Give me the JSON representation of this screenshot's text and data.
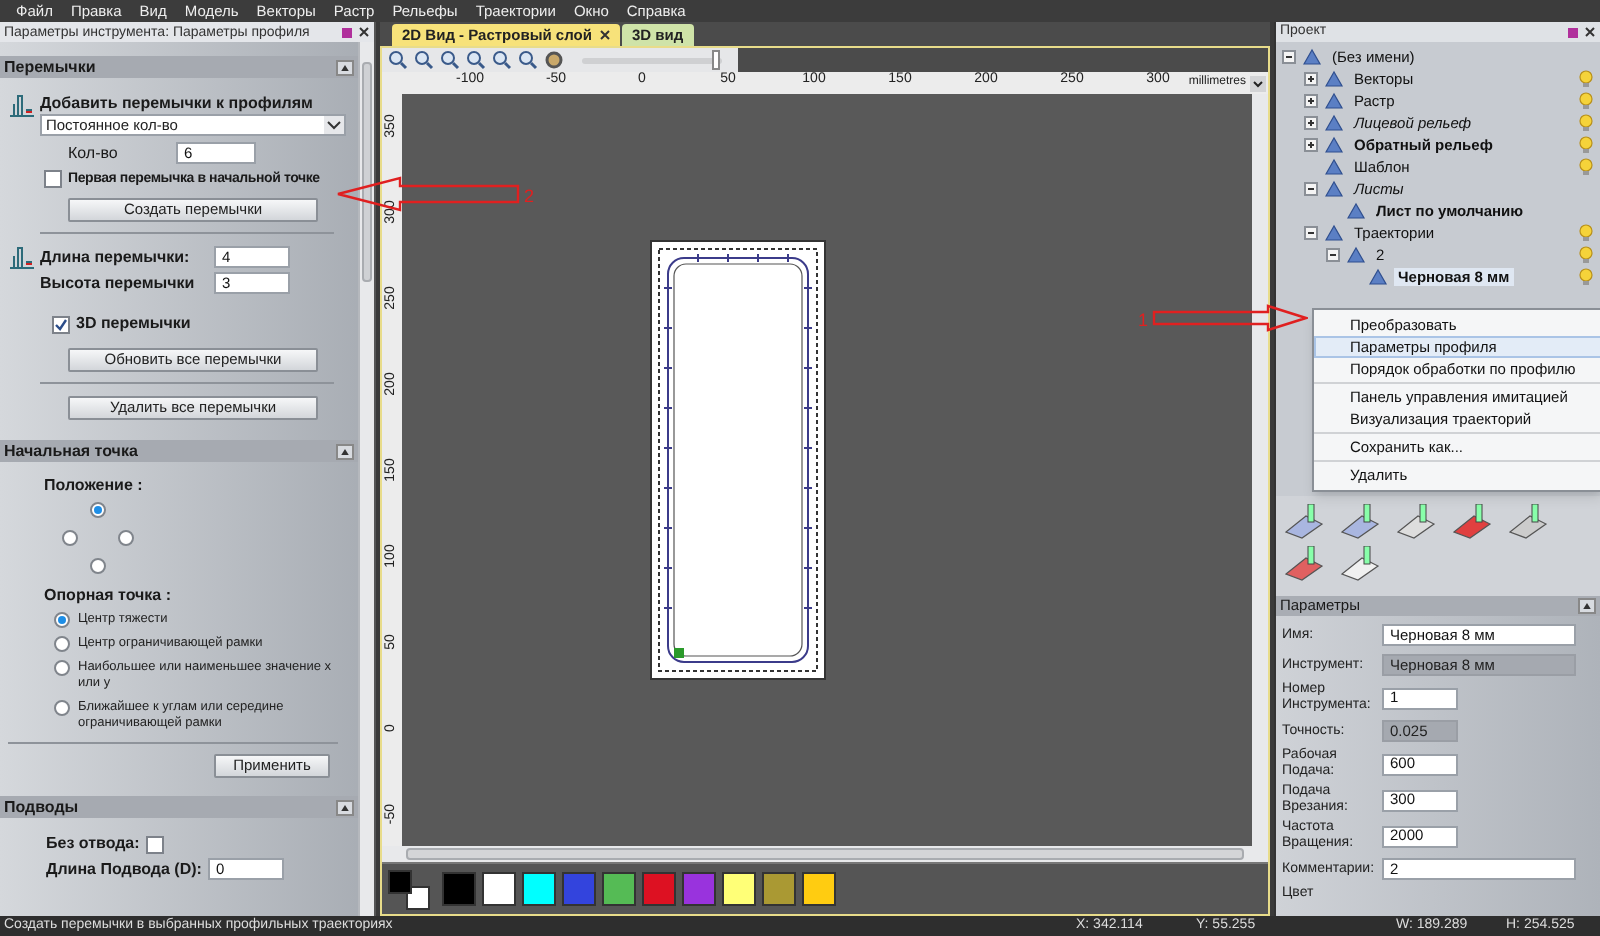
{
  "menu": [
    "Файл",
    "Правка",
    "Вид",
    "Модель",
    "Векторы",
    "Растр",
    "Рельефы",
    "Траектории",
    "Окно",
    "Справка"
  ],
  "left_panel": {
    "title": "Параметры инструмента: Параметры профиля",
    "bridges": {
      "header": "Перемычки",
      "expanded": true,
      "add_label": "Добавить перемычки к профилям",
      "mode": "Постоянное кол-во",
      "count": {
        "label": "Кол-во",
        "value": "6"
      },
      "first_at_start": {
        "label": "Первая перемычка в начальной точке",
        "checked": false
      },
      "create_button": "Создать перемычки",
      "length": {
        "label": "Длина перемычки:",
        "value": "4"
      },
      "height": {
        "label": "Высота перемычки",
        "value": "3"
      },
      "bridges_3d": {
        "label": "3D перемычки",
        "checked": true
      },
      "update_button": "Обновить все перемычки",
      "delete_button": "Удалить все перемычки"
    },
    "start_point": {
      "header": "Начальная точка",
      "expanded": true,
      "position_label": "Положение :",
      "positions": [
        {
          "selected": true
        },
        {
          "selected": false
        },
        {
          "selected": false
        },
        {
          "selected": false
        }
      ],
      "anchor_label": "Опорная точка :",
      "anchors": [
        {
          "label": "Центр тяжести",
          "selected": true
        },
        {
          "label": "Центр ограничивающей рамки",
          "selected": false
        },
        {
          "label": "Наибольшее или наименьшее значение x или y",
          "selected": false
        },
        {
          "label": "Ближайшее к углам или середине ограничивающей рамки",
          "selected": false
        }
      ],
      "apply_button": "Применить"
    },
    "leads": {
      "header": "Подводы",
      "expanded": true,
      "no_lead": {
        "label": "Без отвода:",
        "checked": false
      },
      "lead_length": {
        "label": "Длина Подвода (D):",
        "value": "0"
      }
    }
  },
  "view": {
    "tabs": [
      {
        "label": "2D Вид - Растровый слой",
        "selected": true
      },
      {
        "label": "3D вид",
        "selected": false
      }
    ],
    "zoom_slider": {
      "level": 0.95
    },
    "ruler": {
      "labels": [
        "-100",
        "-50",
        "0",
        "50",
        "100",
        "150",
        "200",
        "250",
        "300"
      ],
      "unit": "millimetres",
      "vertical_labels": [
        "350",
        "300",
        "250",
        "200",
        "150",
        "100",
        "50",
        "0",
        "-50"
      ]
    },
    "palette": {
      "current": [
        {
          "color": "#000000"
        },
        {
          "color": "#ffffff"
        }
      ],
      "swatches": [
        {
          "color": "#000000"
        },
        {
          "color": "#ffffff"
        },
        {
          "color": "#00ffff"
        },
        {
          "color": "#3344dd"
        },
        {
          "color": "#55bb55"
        },
        {
          "color": "#dd1122"
        },
        {
          "color": "#9933dd"
        },
        {
          "color": "#ffff77"
        },
        {
          "color": "#aa9933"
        },
        {
          "color": "#ffcc11"
        }
      ]
    }
  },
  "project": {
    "title": "Проект",
    "tree": [
      {
        "label": "(Без имени)",
        "expanded": true,
        "selected": false,
        "visible": false,
        "bold": false,
        "italic": false,
        "children": [
          {
            "label": "Векторы",
            "expanded": false,
            "selected": false,
            "visible": true,
            "bold": false,
            "italic": false
          },
          {
            "label": "Растр",
            "expanded": false,
            "selected": false,
            "visible": true,
            "bold": false,
            "italic": false
          },
          {
            "label": "Лицевой рельеф",
            "expanded": false,
            "selected": false,
            "visible": true,
            "bold": false,
            "italic": true
          },
          {
            "label": "Обратный рельеф",
            "expanded": false,
            "selected": false,
            "visible": true,
            "bold": true,
            "italic": false
          },
          {
            "label": "Шаблон",
            "selected": false,
            "visible": true,
            "bold": false,
            "italic": false
          },
          {
            "label": "Листы",
            "expanded": true,
            "selected": false,
            "visible": false,
            "bold": false,
            "italic": true,
            "children": [
              {
                "label": "Лист по умолчанию",
                "selected": false,
                "visible": false,
                "bold": true,
                "italic": false
              }
            ]
          },
          {
            "label": "Траектории",
            "expanded": true,
            "selected": false,
            "visible": true,
            "bold": false,
            "italic": false,
            "children": [
              {
                "label": "2",
                "expanded": true,
                "selected": false,
                "visible": true,
                "bold": false,
                "italic": false,
                "children": [
                  {
                    "label": "Черновая 8 мм",
                    "selected": true,
                    "visible": true,
                    "bold": true,
                    "italic": false
                  }
                ]
              }
            ]
          }
        ]
      }
    ],
    "context_menu": [
      [
        {
          "label": "Преобразовать",
          "selected": false
        },
        {
          "label": "Параметры профиля",
          "selected": true
        },
        {
          "label": "Порядок обработки по профилю",
          "selected": false
        }
      ],
      [
        {
          "label": "Панель управления имитацией",
          "selected": false
        },
        {
          "label": "Визуализация траекторий",
          "selected": false
        }
      ],
      [
        {
          "label": "Сохранить как...",
          "selected": false
        }
      ],
      [
        {
          "label": "Удалить",
          "selected": false
        }
      ]
    ],
    "params": {
      "header": "Параметры",
      "fields": [
        {
          "label": "Имя:",
          "value": "Черновая 8 мм",
          "disabled": false,
          "wide": true
        },
        {
          "label": "Инструмент:",
          "value": "Черновая 8 мм",
          "disabled": true,
          "wide": true
        },
        {
          "label": "Номер Инструмента:",
          "value": "1",
          "disabled": false,
          "wide": false
        },
        {
          "label": "Точность:",
          "value": "0.025",
          "disabled": true,
          "wide": false
        },
        {
          "label": "Рабочая Подача:",
          "value": "600",
          "disabled": false,
          "wide": false
        },
        {
          "label": "Подача Врезания:",
          "value": "300",
          "disabled": false,
          "wide": false
        },
        {
          "label": "Частота Вращения:",
          "value": "2000",
          "disabled": false,
          "wide": false
        },
        {
          "label": "Комментарии:",
          "value": "2",
          "disabled": false,
          "wide": true
        }
      ],
      "last_label": "Цвет"
    }
  },
  "annotations": [
    {
      "label": "2",
      "kind": "arrow-left"
    },
    {
      "label": "1",
      "kind": "arrow-right"
    }
  ],
  "status_bar": {
    "message": "Создать перемычки в выбранных профильных траекториях",
    "x": "X: 342.114",
    "y": "Y: 55.255",
    "w": "W: 189.289",
    "h": "H: 254.525"
  }
}
